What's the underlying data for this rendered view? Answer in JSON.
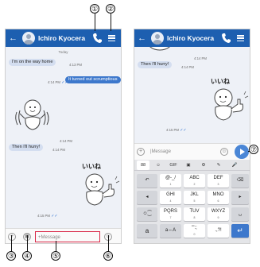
{
  "contact_name": "Ichiro Kyocera",
  "icons": {
    "back": "arrow-left-icon",
    "call": "phone-icon",
    "menu": "hamburger-menu-icon",
    "attach": "plus-icon",
    "sticker": "sticker-icon",
    "emoji": "smiley-icon",
    "send": "send-icon"
  },
  "colors": {
    "appbar": "#1d5fb0",
    "incoming": "#d4def0",
    "outgoing": "#3d78cc",
    "callout_highlight": "#d82444"
  },
  "screen1": {
    "date_label": "Today",
    "messages": [
      {
        "dir": "in",
        "text": "I'm on the way home",
        "time": "4:13 PM"
      },
      {
        "dir": "out",
        "text": "It turned out scrumptious",
        "time": "4:14 PM"
      },
      {
        "dir": "in",
        "kind": "sticker",
        "time": "4:14 PM"
      },
      {
        "dir": "in",
        "text": "Then I'll hurry!",
        "time": "4:14 PM"
      },
      {
        "dir": "out",
        "kind": "sticker",
        "sticker_text": "いいね",
        "time": "4:15 PM"
      }
    ],
    "input_placeholder": "Message"
  },
  "screen2": {
    "top_time": "4:14 PM",
    "messages": [
      {
        "dir": "in",
        "text": "Then I'll hurry!",
        "time": "4:14 PM"
      },
      {
        "dir": "out",
        "kind": "sticker",
        "sticker_text": "いいね",
        "time": "4:15 PM"
      }
    ],
    "input_value": "Message",
    "keyboard": {
      "toolbar": [
        "88",
        "☺",
        "GIF",
        "▣",
        "⚙",
        "✎",
        "🎤"
      ],
      "rows": [
        [
          {
            "main": "↶"
          },
          {
            "main": "@-_/",
            "sub": "1"
          },
          {
            "main": "ABC",
            "sub": "2"
          },
          {
            "main": "DEF",
            "sub": "3"
          },
          {
            "main": "⌫"
          }
        ],
        [
          {
            "main": "◂"
          },
          {
            "main": "GHI",
            "sub": "4"
          },
          {
            "main": "JKL",
            "sub": "5"
          },
          {
            "main": "MNO",
            "sub": "6"
          },
          {
            "main": "▸"
          }
        ],
        [
          {
            "main": "☺⁐"
          },
          {
            "main": "PQRS",
            "sub": "7"
          },
          {
            "main": "TUV",
            "sub": "8"
          },
          {
            "main": "WXYZ",
            "sub": "9"
          },
          {
            "main": "␣"
          }
        ],
        [
          {
            "main": "a"
          },
          {
            "main": "a⇔A"
          },
          {
            "main": "'\":;",
            "sub": "0"
          },
          {
            "main": ".,?!"
          },
          {
            "main": "↵"
          }
        ]
      ]
    }
  },
  "callouts": [
    "①",
    "②",
    "③",
    "④",
    "⑤",
    "⑥",
    "⑦"
  ]
}
